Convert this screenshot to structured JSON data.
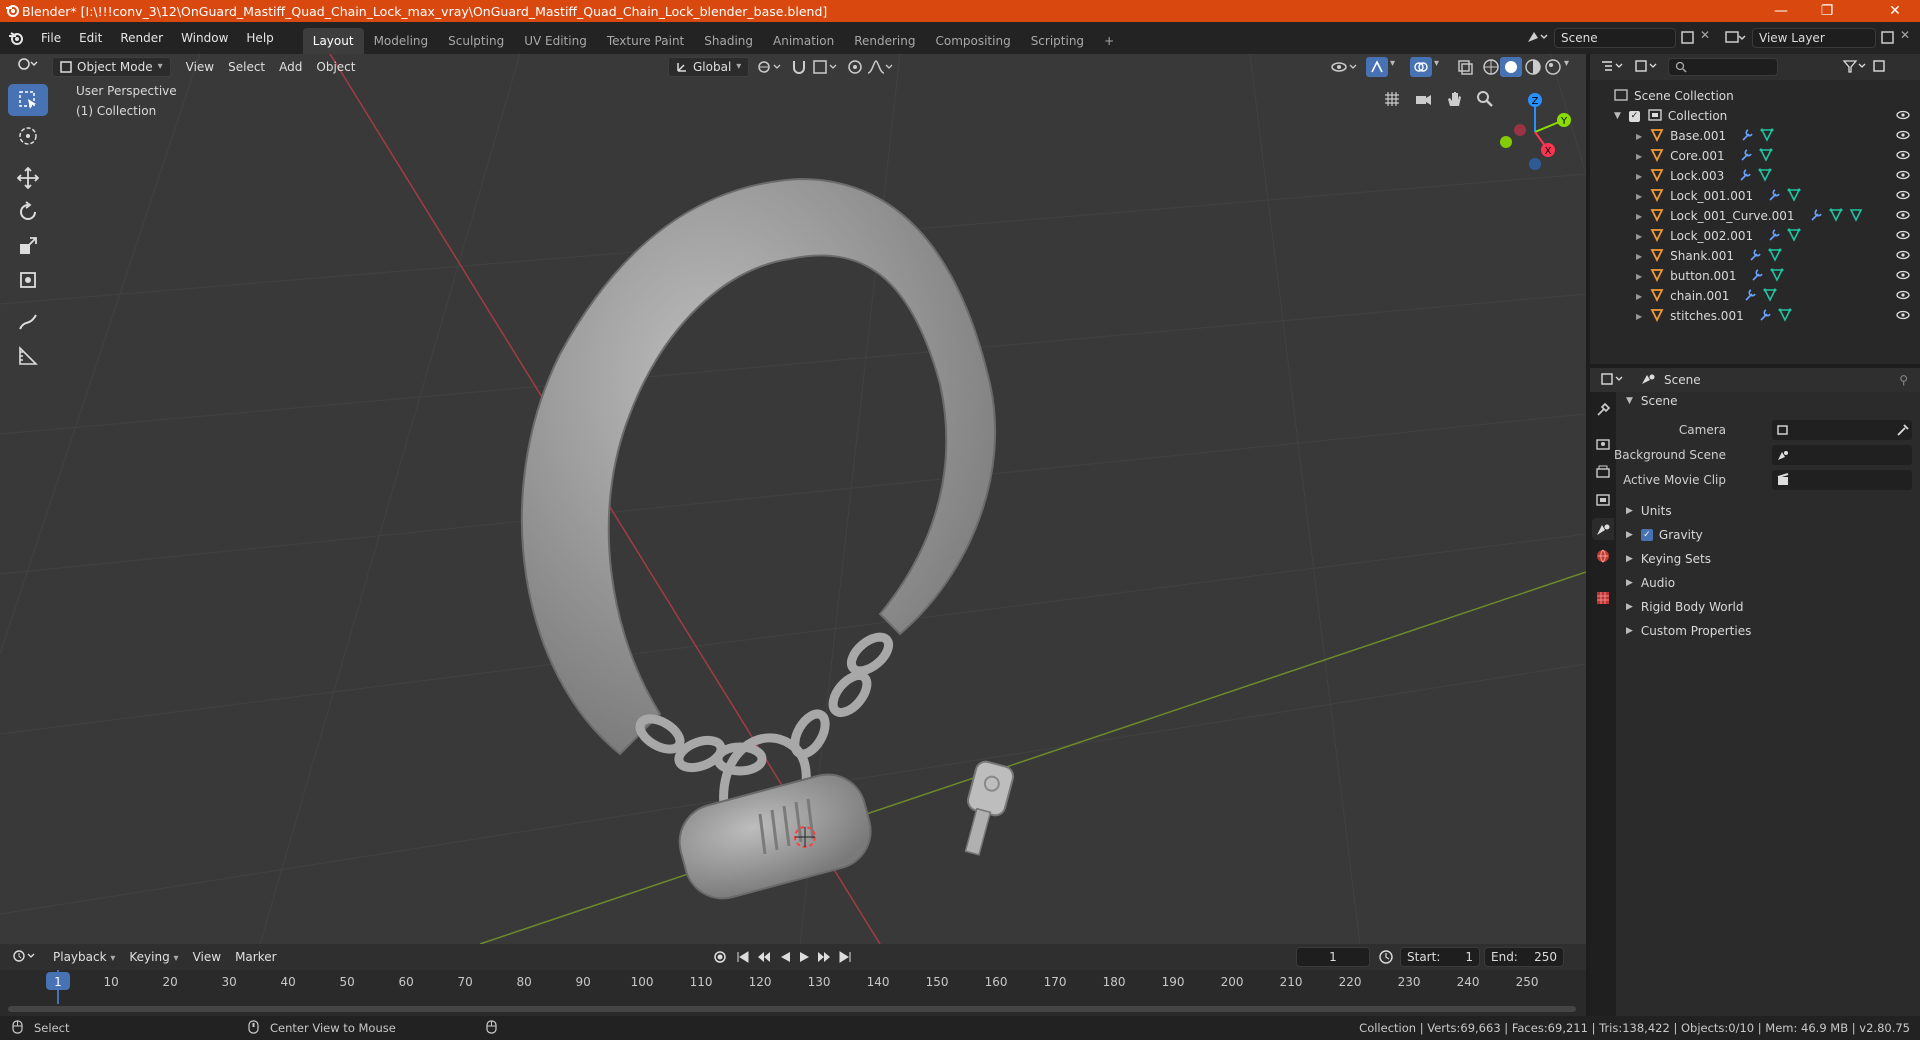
{
  "window": {
    "title": "Blender* [I:\\!!!conv_3\\12\\OnGuard_Mastiff_Quad_Chain_Lock_max_vray\\OnGuard_Mastiff_Quad_Chain_Lock_blender_base.blend]",
    "minimize": "—",
    "maximize": "❐",
    "close": "✕"
  },
  "menus": [
    "File",
    "Edit",
    "Render",
    "Window",
    "Help"
  ],
  "workspaces": [
    "Layout",
    "Modeling",
    "Sculpting",
    "UV Editing",
    "Texture Paint",
    "Shading",
    "Animation",
    "Rendering",
    "Compositing",
    "Scripting"
  ],
  "workspace_add": "+",
  "scene_field": "Scene",
  "view_layer_field": "View Layer",
  "viewport_header": {
    "mode": "Object Mode",
    "menus": [
      "View",
      "Select",
      "Add",
      "Object"
    ],
    "orientation": "Global"
  },
  "viewport": {
    "line1": "User Perspective",
    "line2": "(1) Collection",
    "gizmo": {
      "z": "Z",
      "y": "Y",
      "x": "X"
    }
  },
  "outliner": {
    "root": "Scene Collection",
    "collection": "Collection",
    "objects": [
      "Base.001",
      "Core.001",
      "Lock.003",
      "Lock_001.001",
      "Lock_001_Curve.001",
      "Lock_002.001",
      "Shank.001",
      "button.001",
      "chain.001",
      "stitches.001"
    ]
  },
  "properties": {
    "header": "Scene",
    "panel": "Scene",
    "fields": [
      {
        "label": "Camera"
      },
      {
        "label": "Background Scene"
      },
      {
        "label": "Active Movie Clip"
      }
    ],
    "sections": [
      "Units",
      "Gravity",
      "Keying Sets",
      "Audio",
      "Rigid Body World",
      "Custom Properties"
    ],
    "gravity_checked": true
  },
  "timeline": {
    "menus": [
      "Playback",
      "Keying",
      "View",
      "Marker"
    ],
    "current_frame": "1",
    "start_label": "Start:",
    "start": "1",
    "end_label": "End:",
    "end": "250",
    "ticks": [
      "1",
      "10",
      "20",
      "30",
      "40",
      "50",
      "60",
      "70",
      "80",
      "90",
      "100",
      "110",
      "120",
      "130",
      "140",
      "150",
      "160",
      "170",
      "180",
      "190",
      "200",
      "210",
      "220",
      "230",
      "240",
      "250"
    ]
  },
  "statusbar": {
    "left": "Select",
    "middle": "Center View to Mouse",
    "right": "Collection | Verts:69,663 | Faces:69,211 | Tris:138,422 | Objects:0/10 | Mem: 46.9 MB | v2.80.75"
  },
  "colors": {
    "titlebar": "#d9480f",
    "active_tool": "#4772b3",
    "axis_x": "#ff3352",
    "axis_y": "#8bdc00",
    "axis_z": "#2890ff"
  }
}
